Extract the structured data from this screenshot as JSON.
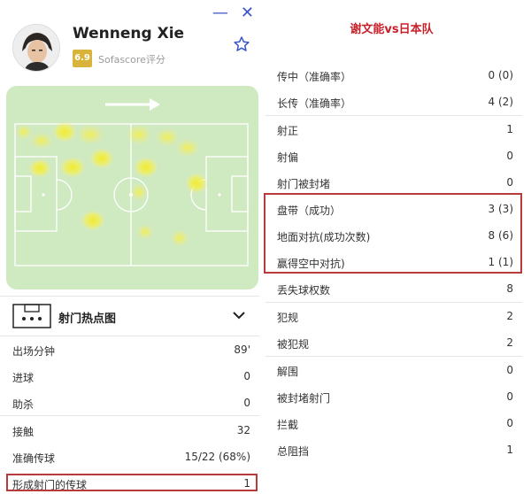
{
  "window": {
    "minimize_glyph": "—",
    "close_glyph": "✕"
  },
  "player": {
    "name": "Wenneng Xie",
    "rating": "6.9",
    "rating_source": "Sofascore评分"
  },
  "heatmap_section": {
    "label": "射门热点图"
  },
  "left_stats": [
    {
      "label": "出场分钟",
      "value": "89'"
    },
    {
      "label": "进球",
      "value": "0"
    },
    {
      "label": "助杀",
      "value": "0"
    },
    {
      "label": "接触",
      "value": "32"
    },
    {
      "label": "准确传球",
      "value": "15/22 (68%)"
    },
    {
      "label": "形成射门的传球",
      "value": "1"
    }
  ],
  "match_title": "谢文能vs日本队",
  "right_stats": [
    {
      "label": "传中（准确率）",
      "value": "0 (0)"
    },
    {
      "label": "长传（准确率）",
      "value": "4 (2)"
    },
    {
      "label": "射正",
      "value": "1"
    },
    {
      "label": "射偏",
      "value": "0"
    },
    {
      "label": "射门被封堵",
      "value": "0"
    },
    {
      "label": "盘带（成功）",
      "value": "3 (3)"
    },
    {
      "label": "地面对抗(成功次数)",
      "value": "8 (6)"
    },
    {
      "label": "赢得空中对抗)",
      "value": "1 (1)"
    },
    {
      "label": "丢失球权数",
      "value": "8"
    },
    {
      "label": "犯规",
      "value": "2"
    },
    {
      "label": "被犯规",
      "value": "2"
    },
    {
      "label": "解围",
      "value": "0"
    },
    {
      "label": "被封堵射门",
      "value": "0"
    },
    {
      "label": "拦截",
      "value": "0"
    },
    {
      "label": "总阻挡",
      "value": "1"
    }
  ],
  "colors": {
    "accent": "#3a55c9",
    "highlight": "#b83b3b",
    "title_red": "#c8202a",
    "pitch": "#cfe9c1",
    "rating": "#d8b43a"
  }
}
